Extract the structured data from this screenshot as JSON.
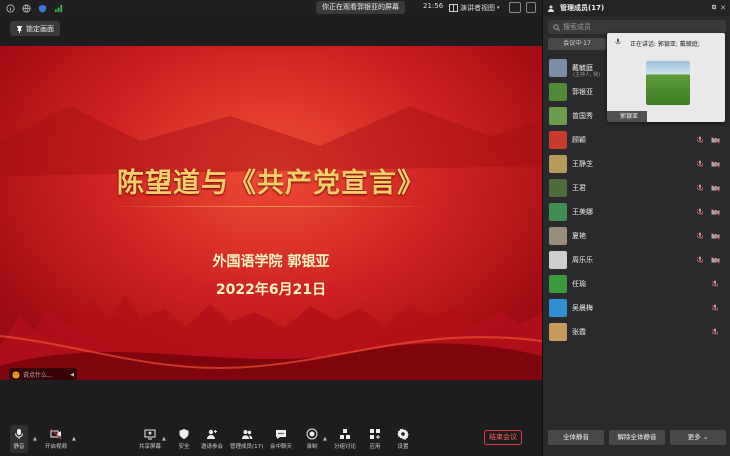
{
  "topbar": {
    "banner": "你正在观看郭银亚的屏幕",
    "time": "21:56",
    "view_mode": "演讲者视图"
  },
  "lock_button": "锁定画面",
  "slide": {
    "title": "陈望道与《共产党宣言》",
    "subtitle": "外国语学院 郭银亚",
    "date": "2022年6月21日"
  },
  "chat_placeholder": "说点什么...",
  "toolbar": {
    "mute": "静音",
    "video": "开启视频",
    "share": "共享屏幕",
    "security": "安全",
    "invite": "邀请参会",
    "members": "管理成员(17)",
    "chat": "会中聊天",
    "record": "录制",
    "breakout": "分组讨论",
    "apps": "应用",
    "settings": "设置",
    "end": "结束会议"
  },
  "panel": {
    "title": "管理成员(17)",
    "search_placeholder": "搜索成员",
    "tab_in_meeting": "会议中·17",
    "speaking": "正在讲话: 郭银亚; 戴毓庭;",
    "popup_name": "郭银亚",
    "members": [
      {
        "name": "戴毓庭",
        "role": "(主持人, 我)",
        "avatar_color": "#7a8ea8"
      },
      {
        "name": "郭银亚",
        "role": "",
        "avatar_color": "#4f8a35"
      },
      {
        "name": "曾国秀",
        "role": "",
        "avatar_color": "#6a9e4a"
      },
      {
        "name": "顾颖",
        "role": "",
        "avatar_color": "#c83a2a"
      },
      {
        "name": "王静芝",
        "role": "",
        "avatar_color": "#b89a5a"
      },
      {
        "name": "王君",
        "role": "",
        "avatar_color": "#4e6b3a"
      },
      {
        "name": "王美娜",
        "role": "",
        "avatar_color": "#3f8f55"
      },
      {
        "name": "夏艳",
        "role": "",
        "avatar_color": "#9a8c7c"
      },
      {
        "name": "周乐乐",
        "role": "",
        "avatar_color": "#cfcfcf"
      },
      {
        "name": "任瑜",
        "role": "",
        "avatar_color": "#3a9a3a"
      },
      {
        "name": "吴晨梅",
        "role": "",
        "avatar_color": "#2f8fd0"
      },
      {
        "name": "张霞",
        "role": "",
        "avatar_color": "#c79a5a"
      }
    ],
    "mute_all": "全体静音",
    "unmute_all": "解除全体静音",
    "more": "更多"
  },
  "colors": {
    "slide_red": "#c4141a",
    "slide_gold": "#f3cf6a",
    "end_red": "#e23b3b"
  }
}
